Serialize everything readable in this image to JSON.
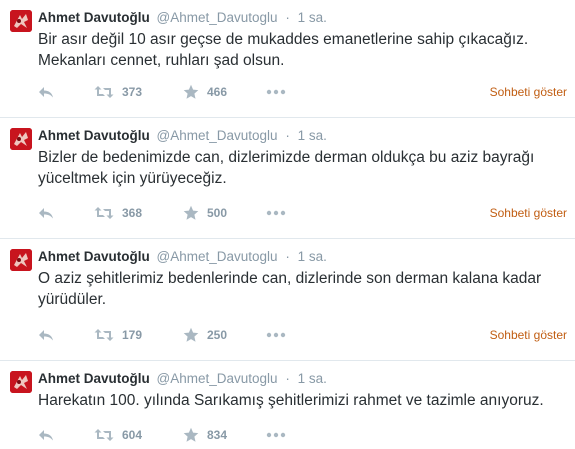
{
  "tweets": [
    {
      "name": "Ahmet Davutoğlu",
      "handle": "@Ahmet_Davutoglu",
      "separator": "·",
      "time": "1 sa.",
      "text": "Bir asır değil 10 asır geçse de mukaddes emanetlerine sahip çıkacağız. Mekanları cennet, ruhları şad olsun.",
      "retweets": "373",
      "favorites": "466",
      "conversation_label": "Sohbeti göster"
    },
    {
      "name": "Ahmet Davutoğlu",
      "handle": "@Ahmet_Davutoglu",
      "separator": "·",
      "time": "1 sa.",
      "text": "Bizler de bedenimizde can, dizlerimizde derman oldukça bu aziz bayrağı yüceltmek için yürüyeceğiz.",
      "retweets": "368",
      "favorites": "500",
      "conversation_label": "Sohbeti göster"
    },
    {
      "name": "Ahmet Davutoğlu",
      "handle": "@Ahmet_Davutoglu",
      "separator": "·",
      "time": "1 sa.",
      "text": "O aziz şehitlerimiz bedenlerinde can, dizlerinde son derman kalana kadar yürüdüler.",
      "retweets": "179",
      "favorites": "250",
      "conversation_label": "Sohbeti göster"
    },
    {
      "name": "Ahmet Davutoğlu",
      "handle": "@Ahmet_Davutoglu",
      "separator": "·",
      "time": "1 sa.",
      "text": "Harekatın 100. yılında Sarıkamış şehitlerimizi rahmet ve tazimle anıyoruz.",
      "retweets": "604",
      "favorites": "834"
    }
  ],
  "icons": {
    "avatar": "profile-photo",
    "reply": "reply-icon",
    "retweet": "retweet-icon",
    "favorite": "star-icon",
    "more": "ellipsis-icon"
  },
  "colors": {
    "text": "#292f33",
    "muted": "#8899a6",
    "link": "#c15e13",
    "divider": "#e1e8ed"
  }
}
